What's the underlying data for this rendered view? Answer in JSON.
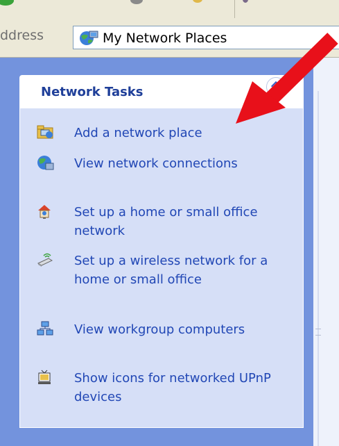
{
  "address": {
    "label": "ddress",
    "value": "My Network Places"
  },
  "tasks": {
    "title": "Network Tasks",
    "items": [
      {
        "label": "Add a network place",
        "icon": "add-network-place-icon"
      },
      {
        "label": "View network connections",
        "icon": "network-connections-icon"
      },
      {
        "label": "Set up a home or small office network",
        "icon": "home-network-icon"
      },
      {
        "label": "Set up a wireless network for a home or small office",
        "icon": "wireless-network-icon"
      },
      {
        "label": "View workgroup computers",
        "icon": "workgroup-icon"
      },
      {
        "label": "Show icons for networked UPnP devices",
        "icon": "upnp-devices-icon"
      }
    ]
  },
  "colors": {
    "pane": "#7393dd",
    "link": "#2147b5",
    "header_title": "#1f3f99",
    "arrow": "#e8101a"
  }
}
